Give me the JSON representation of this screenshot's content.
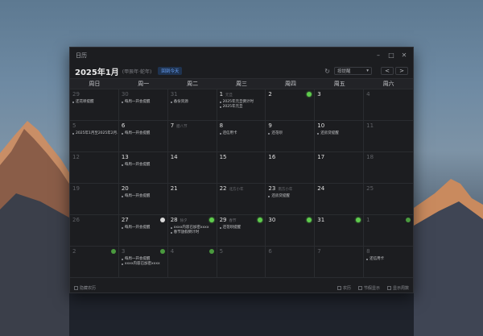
{
  "window": {
    "title": "日历"
  },
  "toolbar": {
    "month_title": "2025年1月",
    "lunar_year": "(甲辰年·蛇年)",
    "today_label": "回到今天",
    "view_select": "按提醒",
    "prev_label": "<",
    "next_label": ">"
  },
  "weekdays": [
    "周日",
    "周一",
    "周二",
    "周三",
    "周四",
    "周五",
    "周六"
  ],
  "cells": [
    {
      "day": "29",
      "other": true,
      "events": [
        "还花呗提醒"
      ]
    },
    {
      "day": "30",
      "other": true,
      "events": [
        "每周一开会提醒"
      ]
    },
    {
      "day": "31",
      "other": true,
      "events": [
        "备份资源"
      ]
    },
    {
      "day": "1",
      "lunar": "元旦",
      "events": [
        "2025年元旦倒计时",
        "2025年元旦"
      ]
    },
    {
      "day": "2",
      "dot": "green"
    },
    {
      "day": "3"
    },
    {
      "day": "4",
      "other": true
    },
    {
      "day": "5",
      "other": true,
      "events": [
        "2025年1月至2025年2月…"
      ]
    },
    {
      "day": "6",
      "events": [
        "每周一开会提醒"
      ]
    },
    {
      "day": "7",
      "lunar": "腊八节"
    },
    {
      "day": "8",
      "events": [
        "还信用卡"
      ]
    },
    {
      "day": "9",
      "events": [
        "还花呗"
      ]
    },
    {
      "day": "10",
      "events": [
        "还房贷提醒"
      ]
    },
    {
      "day": "11",
      "other": true
    },
    {
      "day": "12",
      "other": true
    },
    {
      "day": "13",
      "events": [
        "每周一开会提醒"
      ]
    },
    {
      "day": "14"
    },
    {
      "day": "15"
    },
    {
      "day": "16"
    },
    {
      "day": "17"
    },
    {
      "day": "18",
      "other": true
    },
    {
      "day": "19",
      "other": true
    },
    {
      "day": "20",
      "events": [
        "每周一开会提醒"
      ]
    },
    {
      "day": "21"
    },
    {
      "day": "22",
      "lunar": "北方小年"
    },
    {
      "day": "23",
      "lunar": "南方小年",
      "events": [
        "还房贷提醒"
      ]
    },
    {
      "day": "24"
    },
    {
      "day": "25",
      "other": true
    },
    {
      "day": "26",
      "other": true
    },
    {
      "day": "27",
      "dot": "white",
      "events": [
        "每周一开会提醒"
      ]
    },
    {
      "day": "28",
      "lunar": "除夕",
      "dot": "green",
      "events": [
        "xxxx内容已加密xxxx",
        "春节放假倒计时"
      ]
    },
    {
      "day": "29",
      "lunar": "春节",
      "dot": "green",
      "events": [
        "还花呗提醒"
      ]
    },
    {
      "day": "30",
      "dot": "green"
    },
    {
      "day": "31",
      "dot": "green"
    },
    {
      "day": "1",
      "other": true,
      "dot": "dim"
    },
    {
      "day": "2",
      "other": true,
      "dot": "dim"
    },
    {
      "day": "3",
      "other": true,
      "dot": "dim",
      "events": [
        "每周一开会提醒",
        "xxxx内容已加密xxxx"
      ]
    },
    {
      "day": "4",
      "other": true,
      "dot": "dim"
    },
    {
      "day": "5",
      "other": true
    },
    {
      "day": "6",
      "other": true
    },
    {
      "day": "7",
      "other": true
    },
    {
      "day": "8",
      "other": true,
      "events": [
        "还信用卡"
      ]
    }
  ],
  "footer": {
    "left_check": "隐藏农历",
    "right_checks": [
      "农历",
      "节假显示",
      "显示周数"
    ]
  }
}
